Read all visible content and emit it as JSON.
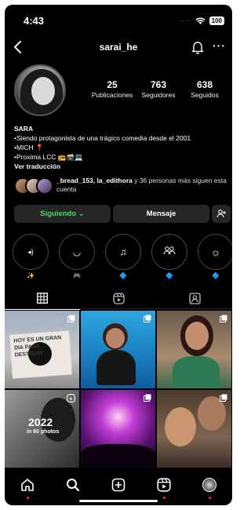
{
  "status_bar": {
    "time": "4:43",
    "battery": "100"
  },
  "header": {
    "username": "sarai_he",
    "more": "···"
  },
  "stats": [
    {
      "value": "25",
      "label": "Publicaciones"
    },
    {
      "value": "763",
      "label": "Seguidores"
    },
    {
      "value": "638",
      "label": "Seguidos"
    }
  ],
  "bio": {
    "name": "SARA",
    "lines": [
      "•Siendo protagonista de una trágico comedia desde el 2001",
      "•MICH 📍",
      "•Proxima LCC 📻🗃️💻"
    ],
    "translate": "Ver traducción"
  },
  "followed_by": {
    "names": "_bread_153, la_edithora",
    "rest": " y 36 personas más siguen esta cuenta"
  },
  "buttons": {
    "following": "Siguiendo ⌄",
    "message": "Mensaje"
  },
  "highlights": [
    {
      "icon": "speaker-icon",
      "glyph": "◂)",
      "label": "✨"
    },
    {
      "icon": "smile-icon",
      "glyph": "◡",
      "label": "🎮"
    },
    {
      "icon": "music-icon",
      "glyph": "♫",
      "label": "🔷"
    },
    {
      "icon": "people-icon",
      "glyph": "👥",
      "label": "🔷"
    },
    {
      "icon": "sun-icon",
      "glyph": "☼",
      "label": "🔷"
    }
  ],
  "grid": {
    "cell1_text": "HOY ES UN GRAN DIA PARA DESTRUIR",
    "cell4_title": "2022",
    "cell4_sub": "in 60 photos"
  },
  "colors": {
    "following": "#4cd964",
    "accent_dot": "#ff3040",
    "button_bg": "#262626"
  }
}
